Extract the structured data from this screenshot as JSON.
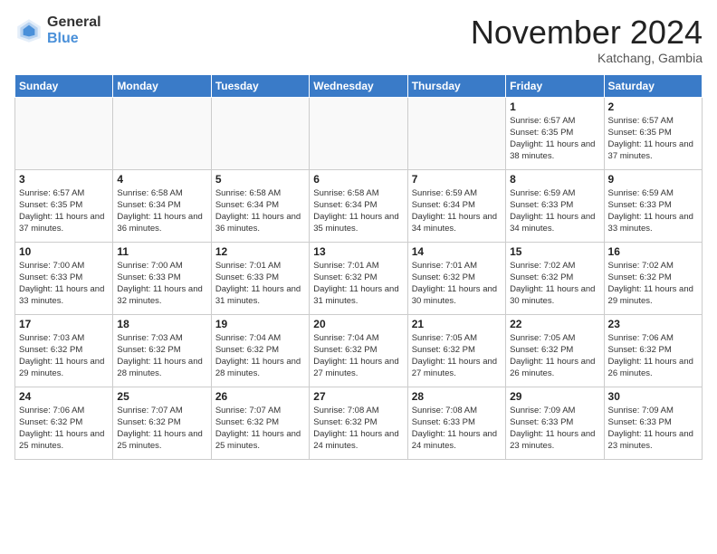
{
  "header": {
    "logo_general": "General",
    "logo_blue": "Blue",
    "month_title": "November 2024",
    "location": "Katchang, Gambia"
  },
  "weekdays": [
    "Sunday",
    "Monday",
    "Tuesday",
    "Wednesday",
    "Thursday",
    "Friday",
    "Saturday"
  ],
  "weeks": [
    [
      {
        "day": "",
        "empty": true
      },
      {
        "day": "",
        "empty": true
      },
      {
        "day": "",
        "empty": true
      },
      {
        "day": "",
        "empty": true
      },
      {
        "day": "",
        "empty": true
      },
      {
        "day": "1",
        "sunrise": "Sunrise: 6:57 AM",
        "sunset": "Sunset: 6:35 PM",
        "daylight": "Daylight: 11 hours and 38 minutes."
      },
      {
        "day": "2",
        "sunrise": "Sunrise: 6:57 AM",
        "sunset": "Sunset: 6:35 PM",
        "daylight": "Daylight: 11 hours and 37 minutes."
      }
    ],
    [
      {
        "day": "3",
        "sunrise": "Sunrise: 6:57 AM",
        "sunset": "Sunset: 6:35 PM",
        "daylight": "Daylight: 11 hours and 37 minutes."
      },
      {
        "day": "4",
        "sunrise": "Sunrise: 6:58 AM",
        "sunset": "Sunset: 6:34 PM",
        "daylight": "Daylight: 11 hours and 36 minutes."
      },
      {
        "day": "5",
        "sunrise": "Sunrise: 6:58 AM",
        "sunset": "Sunset: 6:34 PM",
        "daylight": "Daylight: 11 hours and 36 minutes."
      },
      {
        "day": "6",
        "sunrise": "Sunrise: 6:58 AM",
        "sunset": "Sunset: 6:34 PM",
        "daylight": "Daylight: 11 hours and 35 minutes."
      },
      {
        "day": "7",
        "sunrise": "Sunrise: 6:59 AM",
        "sunset": "Sunset: 6:34 PM",
        "daylight": "Daylight: 11 hours and 34 minutes."
      },
      {
        "day": "8",
        "sunrise": "Sunrise: 6:59 AM",
        "sunset": "Sunset: 6:33 PM",
        "daylight": "Daylight: 11 hours and 34 minutes."
      },
      {
        "day": "9",
        "sunrise": "Sunrise: 6:59 AM",
        "sunset": "Sunset: 6:33 PM",
        "daylight": "Daylight: 11 hours and 33 minutes."
      }
    ],
    [
      {
        "day": "10",
        "sunrise": "Sunrise: 7:00 AM",
        "sunset": "Sunset: 6:33 PM",
        "daylight": "Daylight: 11 hours and 33 minutes."
      },
      {
        "day": "11",
        "sunrise": "Sunrise: 7:00 AM",
        "sunset": "Sunset: 6:33 PM",
        "daylight": "Daylight: 11 hours and 32 minutes."
      },
      {
        "day": "12",
        "sunrise": "Sunrise: 7:01 AM",
        "sunset": "Sunset: 6:33 PM",
        "daylight": "Daylight: 11 hours and 31 minutes."
      },
      {
        "day": "13",
        "sunrise": "Sunrise: 7:01 AM",
        "sunset": "Sunset: 6:32 PM",
        "daylight": "Daylight: 11 hours and 31 minutes."
      },
      {
        "day": "14",
        "sunrise": "Sunrise: 7:01 AM",
        "sunset": "Sunset: 6:32 PM",
        "daylight": "Daylight: 11 hours and 30 minutes."
      },
      {
        "day": "15",
        "sunrise": "Sunrise: 7:02 AM",
        "sunset": "Sunset: 6:32 PM",
        "daylight": "Daylight: 11 hours and 30 minutes."
      },
      {
        "day": "16",
        "sunrise": "Sunrise: 7:02 AM",
        "sunset": "Sunset: 6:32 PM",
        "daylight": "Daylight: 11 hours and 29 minutes."
      }
    ],
    [
      {
        "day": "17",
        "sunrise": "Sunrise: 7:03 AM",
        "sunset": "Sunset: 6:32 PM",
        "daylight": "Daylight: 11 hours and 29 minutes."
      },
      {
        "day": "18",
        "sunrise": "Sunrise: 7:03 AM",
        "sunset": "Sunset: 6:32 PM",
        "daylight": "Daylight: 11 hours and 28 minutes."
      },
      {
        "day": "19",
        "sunrise": "Sunrise: 7:04 AM",
        "sunset": "Sunset: 6:32 PM",
        "daylight": "Daylight: 11 hours and 28 minutes."
      },
      {
        "day": "20",
        "sunrise": "Sunrise: 7:04 AM",
        "sunset": "Sunset: 6:32 PM",
        "daylight": "Daylight: 11 hours and 27 minutes."
      },
      {
        "day": "21",
        "sunrise": "Sunrise: 7:05 AM",
        "sunset": "Sunset: 6:32 PM",
        "daylight": "Daylight: 11 hours and 27 minutes."
      },
      {
        "day": "22",
        "sunrise": "Sunrise: 7:05 AM",
        "sunset": "Sunset: 6:32 PM",
        "daylight": "Daylight: 11 hours and 26 minutes."
      },
      {
        "day": "23",
        "sunrise": "Sunrise: 7:06 AM",
        "sunset": "Sunset: 6:32 PM",
        "daylight": "Daylight: 11 hours and 26 minutes."
      }
    ],
    [
      {
        "day": "24",
        "sunrise": "Sunrise: 7:06 AM",
        "sunset": "Sunset: 6:32 PM",
        "daylight": "Daylight: 11 hours and 25 minutes."
      },
      {
        "day": "25",
        "sunrise": "Sunrise: 7:07 AM",
        "sunset": "Sunset: 6:32 PM",
        "daylight": "Daylight: 11 hours and 25 minutes."
      },
      {
        "day": "26",
        "sunrise": "Sunrise: 7:07 AM",
        "sunset": "Sunset: 6:32 PM",
        "daylight": "Daylight: 11 hours and 25 minutes."
      },
      {
        "day": "27",
        "sunrise": "Sunrise: 7:08 AM",
        "sunset": "Sunset: 6:32 PM",
        "daylight": "Daylight: 11 hours and 24 minutes."
      },
      {
        "day": "28",
        "sunrise": "Sunrise: 7:08 AM",
        "sunset": "Sunset: 6:33 PM",
        "daylight": "Daylight: 11 hours and 24 minutes."
      },
      {
        "day": "29",
        "sunrise": "Sunrise: 7:09 AM",
        "sunset": "Sunset: 6:33 PM",
        "daylight": "Daylight: 11 hours and 23 minutes."
      },
      {
        "day": "30",
        "sunrise": "Sunrise: 7:09 AM",
        "sunset": "Sunset: 6:33 PM",
        "daylight": "Daylight: 11 hours and 23 minutes."
      }
    ]
  ]
}
